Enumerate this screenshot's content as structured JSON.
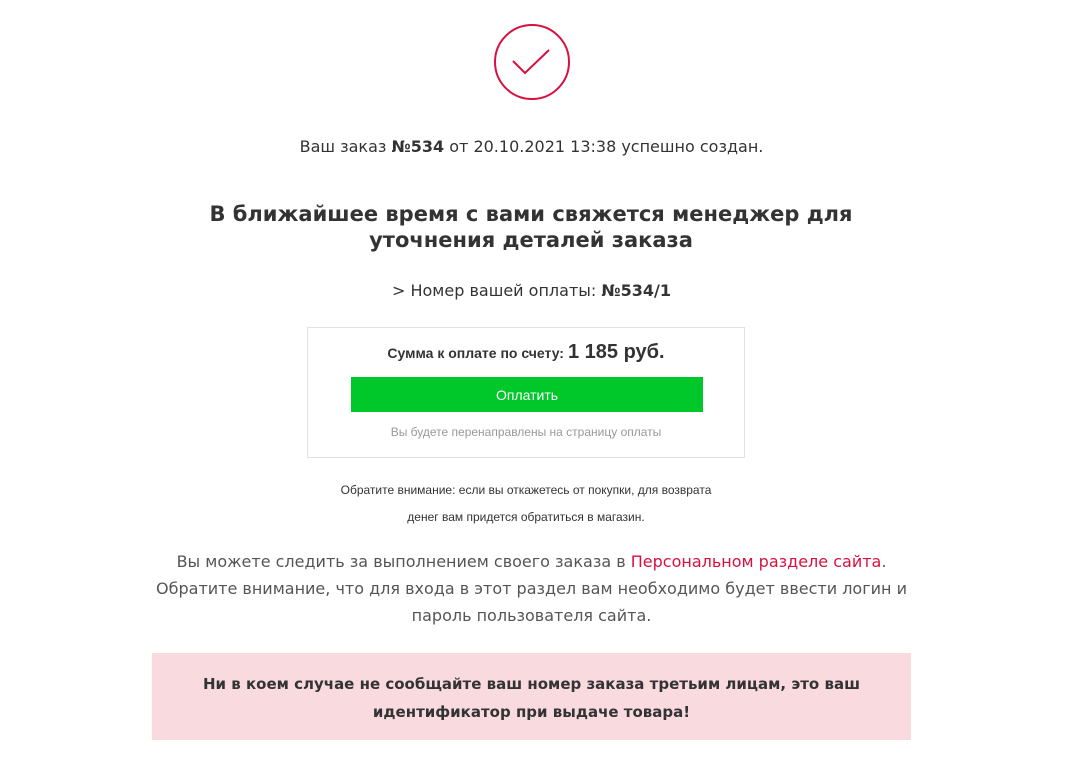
{
  "icons": {
    "success": "checkmark-circle-icon",
    "accent_color": "#d9103f"
  },
  "order": {
    "prefix": "Ваш заказ ",
    "number": "№534",
    "middle": " от 20.10.2021 13:38 успешно создан."
  },
  "headline": "В ближайшее время с вами свяжется менеджер для уточнения деталей заказа",
  "payment": {
    "number_prefix": "> Номер вашей оплаты: ",
    "number": "№534/1",
    "sum_label": "Сумма к оплате по счету:",
    "sum_amount": "1 185 руб.",
    "button_label": "Оплатить",
    "button_color": "#00c82a",
    "redirect_note": "Вы будете перенаправлены на страницу оплаты"
  },
  "refund_notice": {
    "line1": "Обратите внимание: если вы откажетесь от покупки, для возврата",
    "line2": "денег вам придется обратиться в магазин."
  },
  "tracking": {
    "text_before": "Вы можете следить за выполнением своего заказа в ",
    "link_text": "Персональном разделе сайта",
    "text_after": ".",
    "line2": "Обратите внимание, что для входа в этот раздел вам необходимо будет ввести логин и пароль пользователя сайта."
  },
  "warning": {
    "text": "Ни в коем случае не сообщайте ваш номер заказа третьим лицам, это ваш идентификатор при выдаче товара!",
    "background": "#f8dadf"
  }
}
